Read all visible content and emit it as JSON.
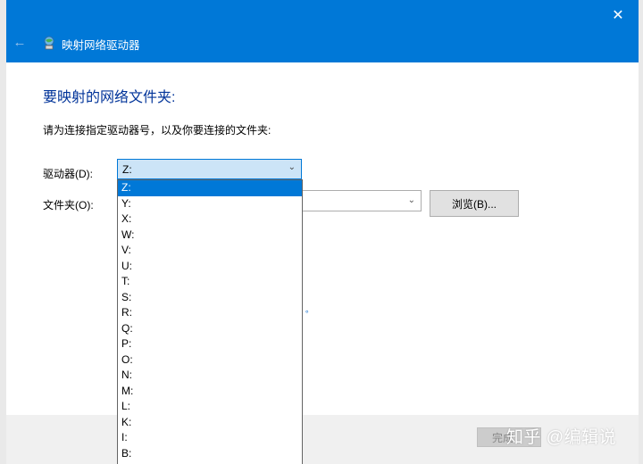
{
  "window": {
    "title": "映射网络驱动器",
    "close_glyph": "✕",
    "back_glyph": "←"
  },
  "main": {
    "heading": "要映射的网络文件夹:",
    "instruction": "请为连接指定驱动器号，以及你要连接的文件夹:",
    "drive_label": "驱动器(D):",
    "drive_value": "Z:",
    "folder_label": "文件夹(O):",
    "folder_value": "",
    "browse_label": "浏览(B)...",
    "hidden_link_fragment": "。"
  },
  "drive_options": [
    "Z:",
    "Y:",
    "X:",
    "W:",
    "V:",
    "U:",
    "T:",
    "S:",
    "R:",
    "Q:",
    "P:",
    "O:",
    "N:",
    "M:",
    "L:",
    "K:",
    "I:",
    "B:"
  ],
  "selected_drive_index": 0,
  "footer": {
    "finish_label": "完成",
    "watermark": "知乎 @编辑说"
  },
  "colors": {
    "titlebar": "#0078d7",
    "heading": "#003399",
    "selection": "#0078d7"
  }
}
